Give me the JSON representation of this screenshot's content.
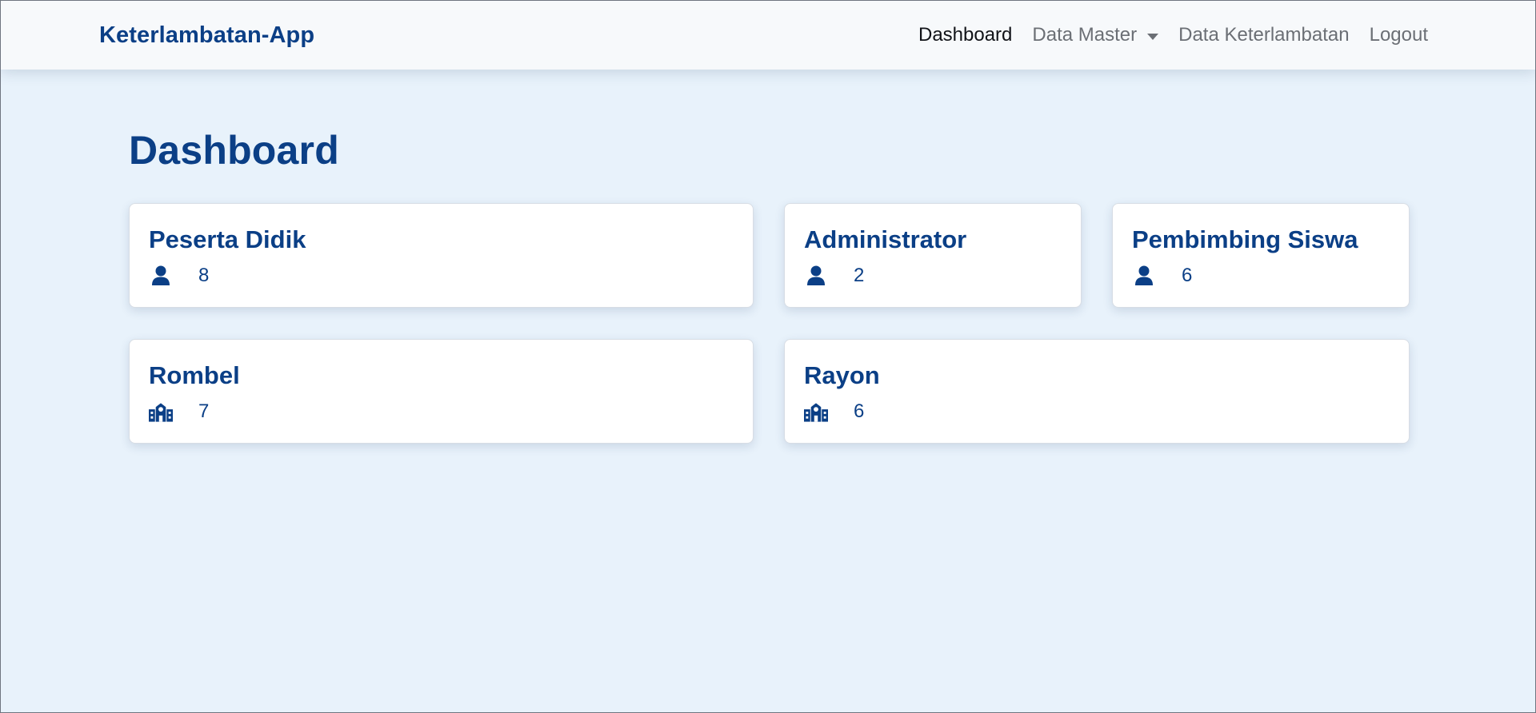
{
  "app": {
    "brand": "Keterlambatan-App"
  },
  "nav": {
    "items": [
      {
        "label": "Dashboard",
        "active": true,
        "has_dropdown": false
      },
      {
        "label": "Data Master",
        "active": false,
        "has_dropdown": true
      },
      {
        "label": "Data Keterlambatan",
        "active": false,
        "has_dropdown": false
      },
      {
        "label": "Logout",
        "active": false,
        "has_dropdown": false
      }
    ]
  },
  "page": {
    "title": "Dashboard"
  },
  "cards": [
    {
      "title": "Peserta Didik",
      "icon": "user-icon",
      "value": "8"
    },
    {
      "title": "Administrator",
      "icon": "user-icon",
      "value": "2"
    },
    {
      "title": "Pembimbing Siswa",
      "icon": "user-icon",
      "value": "6"
    },
    {
      "title": "Rombel",
      "icon": "school-icon",
      "value": "7"
    },
    {
      "title": "Rayon",
      "icon": "school-icon",
      "value": "6"
    }
  ],
  "colors": {
    "primary": "#0b3f86",
    "background": "#e8f2fb",
    "navbar": "#f7f9fb",
    "card": "#ffffff"
  }
}
